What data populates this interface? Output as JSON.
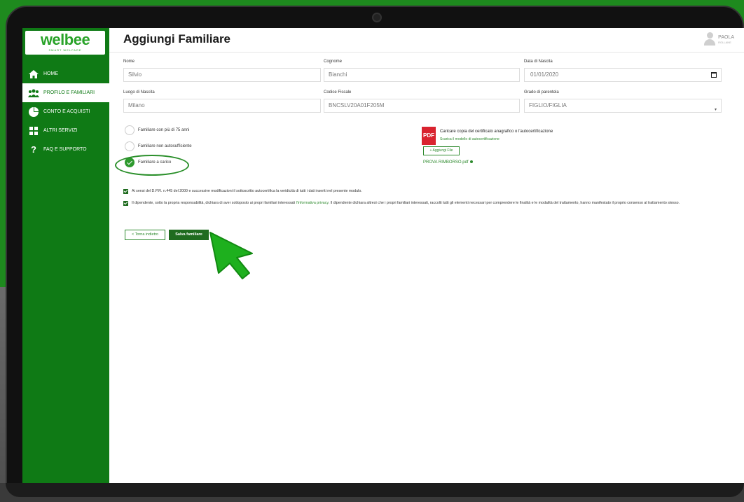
{
  "app": {
    "logo": "welbee",
    "logo_sub": "SMART WELFARE"
  },
  "sidebar": {
    "items": [
      {
        "label": "HOME",
        "icon": "home-icon"
      },
      {
        "label": "PROFILO E FAMILIARI",
        "icon": "users-icon",
        "active": true
      },
      {
        "label": "CONTO E ACQUISTI",
        "icon": "pie-chart-icon"
      },
      {
        "label": "ALTRI SERVIZI",
        "icon": "grid-icon"
      },
      {
        "label": "FAQ E SUPPORTO",
        "icon": "question-icon"
      }
    ]
  },
  "header": {
    "title": "Aggiungi Familiare",
    "user_name": "PAOLA",
    "user_role": "ROLLANE"
  },
  "form": {
    "nome": {
      "label": "Nome",
      "value": "Silvio"
    },
    "cognome": {
      "label": "Cognome",
      "value": "Bianchi"
    },
    "data_nascita": {
      "label": "Data di Nascita",
      "value": "01/01/2020"
    },
    "luogo_nascita": {
      "label": "Luogo di Nascita",
      "value": "Milano"
    },
    "codice_fiscale": {
      "label": "Codice Fiscale",
      "value": "BNCSLV20A01F205M"
    },
    "grado_parentela": {
      "label": "Grado di parentela",
      "value": "FIGLIO/FIGLIA"
    }
  },
  "radios": [
    {
      "label": "Familiare con più di 75 anni",
      "checked": false
    },
    {
      "label": "Familiare non autosufficiente",
      "checked": false
    },
    {
      "label": "Familiare a carico",
      "checked": true
    }
  ],
  "upload": {
    "title": "Caricare copia del certificato anagrafico o l'autocertificazione",
    "subtitle": "Scarica il modello di autocertificazione",
    "add_button": "+ Aggiungi File",
    "file_name": "PROVA RIMBORSO.pdf"
  },
  "declarations": [
    {
      "text": "Ai sensi del D.P.R. n.445 del 2000 e successive modificazioni il sottoscritto autocertifica la veridicità di tutti i dati inseriti nel presente modulo."
    },
    {
      "text_before": "Il dipendente, sotto la propria responsabilità, dichiara di aver sottoposto ai propri familiari interessati ",
      "link": "l'informativa privacy",
      "text_after": ". Il dipendente dichiara altresì che i propri familiari interessati, raccolti tutti gli elementi necessari per comprendere le finalità e le modalità del trattamento, hanno manifestato il proprio consenso al trattamento stesso."
    }
  ],
  "buttons": {
    "back": "< Torna indietro",
    "save": "Salva familiare"
  },
  "colors": {
    "brand_green": "#0f7a15",
    "accent_green": "#2e8a2e",
    "background_green": "#1e8a1e",
    "pdf_red": "#d9232f"
  }
}
